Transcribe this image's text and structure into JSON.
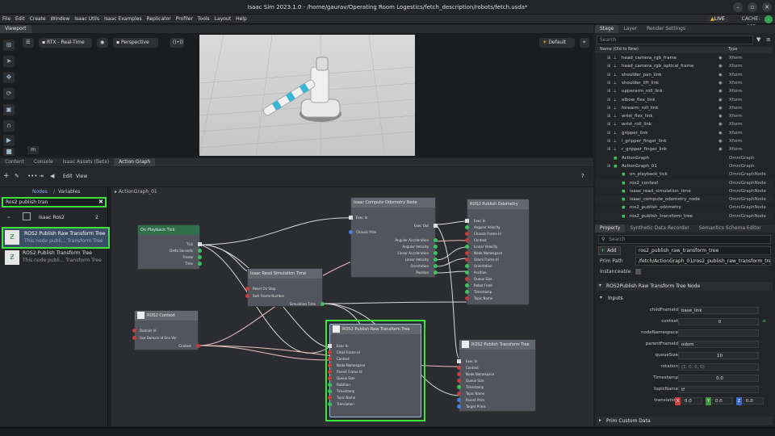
{
  "app": {
    "title": "Isaac Sim 2023.1.0 - /home/gaurav/Operating Room Logestics/fetch_description/robots/fetch.usda*",
    "live_label": "LIVE",
    "cache_label": "CACHE: OFF"
  },
  "menu": [
    "File",
    "Edit",
    "Create",
    "Window",
    "Isaac Utils",
    "Isaac Examples",
    "Replicator",
    "Profiler",
    "Tools",
    "Layout",
    "Help"
  ],
  "viewport": {
    "tab": "Viewport",
    "render_mode": "RTX - Real-Time",
    "camera": "Perspective",
    "lighting": "Default",
    "corner_label": "m"
  },
  "bottom_tabs": [
    "Content",
    "Console",
    "Isaac Assets (Beta)",
    "Action Graph"
  ],
  "action_graph": {
    "toolbar": [
      "Edit",
      "View"
    ],
    "help": "?",
    "panel_tabs": [
      "Nodes",
      "Variables"
    ],
    "search_value": "Ros2 publish tran",
    "category": "Isaac Ros2",
    "category_count": "2",
    "results": [
      {
        "title": "ROS2 Publish Raw Transform Tree",
        "desc": "This node publi... Transform Tree"
      },
      {
        "title": "ROS2 Publish Transform Tree",
        "desc": "This node publi... Transform Tree"
      }
    ],
    "breadcrumb": "ActionGraph_01",
    "nodes": {
      "playback": {
        "title": "On Playback Tick",
        "ports": [
          "Tick",
          "Delta Seconds",
          "Frame",
          "Time"
        ]
      },
      "ros2_context": {
        "title": "ROS2 Context",
        "ports": [
          "Domain Id",
          "Use Domain Id Env Var",
          "Context"
        ]
      },
      "sim_time": {
        "title": "Isaac Read Simulation Time",
        "ports": [
          "Reset On Stop",
          "Swh Frame Number",
          "Simulation Time"
        ]
      },
      "odom_compute": {
        "title": "Isaac Compute Odometry Node",
        "ports": [
          "Exec In",
          "Chassis Prim",
          "Exec Out",
          "Angular Acceleration",
          "Angular Velocity",
          "Linear Acceleration",
          "Linear Velocity",
          "Orientation",
          "Position"
        ]
      },
      "pub_odom": {
        "title": "ROS2 Publish Odometry",
        "ports": [
          "Exec In",
          "Angular Velocity",
          "Chassis Frame Id",
          "Context",
          "Linear Velocity",
          "Node Namespace",
          "Odom Frame Id",
          "Orientation",
          "Position",
          "Queue Size",
          "Robot Front",
          "Timestamp",
          "Topic Name"
        ]
      },
      "raw_tf": {
        "title": "ROS2 Publish Raw Transform Tree",
        "ports": [
          "Exec In",
          "Child Frame Id",
          "Context",
          "Node Namespace",
          "Parent Frame Id",
          "Queue Size",
          "Rotation",
          "Timestamp",
          "Topic Name",
          "Translation"
        ]
      },
      "tf_tree": {
        "title": "ROS2 Publish Transform Tree",
        "ports": [
          "Exec In",
          "Context",
          "Node Namespace",
          "Queue Size",
          "Timestamp",
          "Topic Name",
          "Parent Prim",
          "Target Prims"
        ]
      }
    }
  },
  "stage": {
    "tabs": [
      "Stage",
      "Layer",
      "Render Settings"
    ],
    "search_placeholder": "Search",
    "col_name": "Name (Old to New)",
    "col_type": "Type",
    "rows": [
      {
        "name": "head_camera_rgb_frame",
        "type": "Xform"
      },
      {
        "name": "head_camera_rgb_optical_frame",
        "type": "Xform"
      },
      {
        "name": "shoulder_pan_link",
        "type": "Xform"
      },
      {
        "name": "shoulder_lift_link",
        "type": "Xform"
      },
      {
        "name": "upperarm_roll_link",
        "type": "Xform"
      },
      {
        "name": "elbow_flex_link",
        "type": "Xform"
      },
      {
        "name": "forearm_roll_link",
        "type": "Xform"
      },
      {
        "name": "wrist_flex_link",
        "type": "Xform"
      },
      {
        "name": "wrist_roll_link",
        "type": "Xform"
      },
      {
        "name": "gripper_link",
        "type": "Xform"
      },
      {
        "name": "l_gripper_finger_link",
        "type": "Xform"
      },
      {
        "name": "r_gripper_finger_link",
        "type": "Xform"
      },
      {
        "name": "ActionGraph",
        "type": "OmniGraph"
      },
      {
        "name": "ActionGraph_01",
        "type": "OmniGraph"
      },
      {
        "name": "on_playback_tick",
        "type": "OmniGraphNode"
      },
      {
        "name": "ros2_context",
        "type": "OmniGraphNode"
      },
      {
        "name": "isaac_read_simulation_time",
        "type": "OmniGraphNode"
      },
      {
        "name": "isaac_compute_odometry_node",
        "type": "OmniGraphNode"
      },
      {
        "name": "ros2_publish_odometry",
        "type": "OmniGraphNode"
      },
      {
        "name": "ros2_publish_transform_tree",
        "type": "OmniGraphNode"
      }
    ]
  },
  "property": {
    "tabs": [
      "Property",
      "Synthetic Data Recorder",
      "Semantics Schema Editor"
    ],
    "search_placeholder": "Search",
    "add_label": "Add",
    "name_value": "ros2_publish_raw_transform_tree",
    "prim_path_label": "Prim Path",
    "prim_path_value": "/fetch/ActionGraph_01/ros2_publish_raw_transform_tree",
    "instanceable_label": "Instanceable",
    "section_title": "ROS2Publish Raw Transform Tree Node",
    "inputs_title": "Inputs",
    "inputs": [
      {
        "label": "childFrameId",
        "value": "base_link"
      },
      {
        "label": "context",
        "value": "0"
      },
      {
        "label": "nodeNamespace",
        "value": ""
      },
      {
        "label": "parentFrameId",
        "value": "odom"
      },
      {
        "label": "queueSize",
        "value": "10"
      },
      {
        "label": "rotation",
        "value": "(1, 0, 0, 0)"
      },
      {
        "label": "Timestamp",
        "value": "0.0"
      },
      {
        "label": "topicName",
        "value": "tf"
      }
    ],
    "translation_label": "translation",
    "translation": {
      "x": "0.0",
      "y": "0.0",
      "z": "0.0"
    },
    "custom_data_title": "Prim Custom Data"
  }
}
